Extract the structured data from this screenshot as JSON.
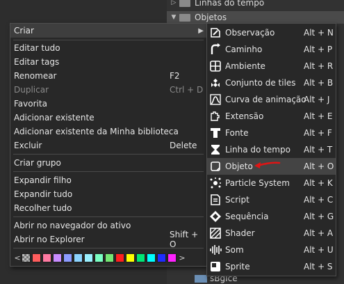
{
  "tree": {
    "rows": [
      {
        "label": "Linhas do tempo",
        "arrow": "▷"
      },
      {
        "label": "Objetos",
        "arrow": "▼"
      }
    ],
    "bottom_label": "sBgIce"
  },
  "menu": {
    "items": [
      {
        "label": "Criar",
        "shortcut": ""
      },
      {
        "label": "Editar tudo",
        "shortcut": ""
      },
      {
        "label": "Editar tags",
        "shortcut": ""
      },
      {
        "label": "Renomear",
        "shortcut": "F2"
      },
      {
        "label": "Duplicar",
        "shortcut": "Ctrl + D"
      },
      {
        "label": "Favorita",
        "shortcut": ""
      },
      {
        "label": "Adicionar existente",
        "shortcut": ""
      },
      {
        "label": "Adicionar existente da Minha biblioteca",
        "shortcut": ""
      },
      {
        "label": "Excluir",
        "shortcut": "Delete"
      },
      {
        "label": "Criar grupo",
        "shortcut": ""
      },
      {
        "label": "Expandir filho",
        "shortcut": ""
      },
      {
        "label": "Expandir tudo",
        "shortcut": ""
      },
      {
        "label": "Recolher tudo",
        "shortcut": ""
      },
      {
        "label": "Abrir no navegador do ativo",
        "shortcut": ""
      },
      {
        "label": "Abrir no Explorer",
        "shortcut": "Shift + O"
      }
    ],
    "palette": {
      "left_arrow": "<",
      "right_arrow": ">",
      "colors": [
        "checker",
        "#ff5d5d",
        "#ff7aa2",
        "#c88cff",
        "#8c9bff",
        "#8cd4ff",
        "#9af0ff",
        "#7affc3",
        "#74e673",
        "#ff1f1f",
        "#ffff00",
        "#00e676",
        "#00ffff",
        "#1e2dff",
        "#ff22ff"
      ]
    }
  },
  "submenu": {
    "items": [
      {
        "label": "Observação",
        "shortcut": "Alt + N",
        "icon": "note-icon"
      },
      {
        "label": "Caminho",
        "shortcut": "Alt + P",
        "icon": "path-icon"
      },
      {
        "label": "Ambiente",
        "shortcut": "Alt + R",
        "icon": "room-icon"
      },
      {
        "label": "Conjunto de tiles",
        "shortcut": "Alt + B",
        "icon": "tileset-icon"
      },
      {
        "label": "Curva de animação",
        "shortcut": "Alt + J",
        "icon": "animation-curve-icon"
      },
      {
        "label": "Extensão",
        "shortcut": "Alt + E",
        "icon": "extension-icon"
      },
      {
        "label": "Fonte",
        "shortcut": "Alt + F",
        "icon": "font-icon"
      },
      {
        "label": "Linha do tempo",
        "shortcut": "Alt + T",
        "icon": "timeline-icon"
      },
      {
        "label": "Objeto",
        "shortcut": "Alt + O",
        "icon": "object-icon"
      },
      {
        "label": "Particle System",
        "shortcut": "Alt + K",
        "icon": "particle-system-icon"
      },
      {
        "label": "Script",
        "shortcut": "Alt + C",
        "icon": "script-icon"
      },
      {
        "label": "Sequência",
        "shortcut": "Alt + G",
        "icon": "sequence-icon"
      },
      {
        "label": "Shader",
        "shortcut": "Alt + A",
        "icon": "shader-icon"
      },
      {
        "label": "Som",
        "shortcut": "Alt + U",
        "icon": "sound-icon"
      },
      {
        "label": "Sprite",
        "shortcut": "Alt + S",
        "icon": "sprite-icon"
      }
    ]
  }
}
